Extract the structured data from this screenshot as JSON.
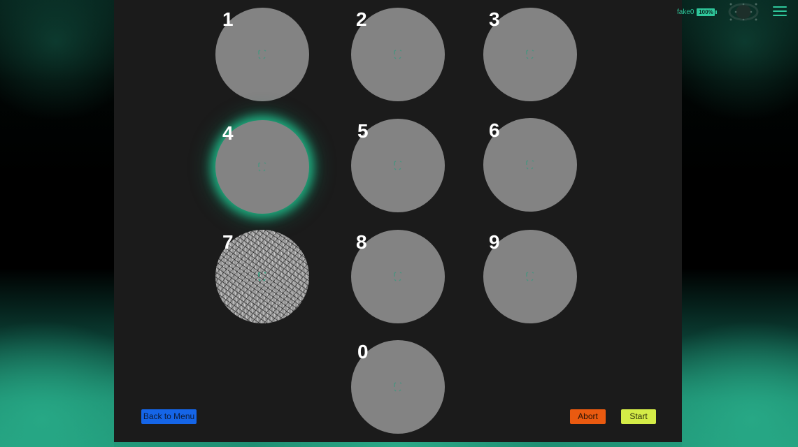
{
  "targets": [
    {
      "label": "1",
      "active": false,
      "noise": false
    },
    {
      "label": "2",
      "active": false,
      "noise": false
    },
    {
      "label": "3",
      "active": false,
      "noise": false
    },
    {
      "label": "4",
      "active": true,
      "noise": false
    },
    {
      "label": "5",
      "active": false,
      "noise": false
    },
    {
      "label": "6",
      "active": false,
      "noise": false
    },
    {
      "label": "7",
      "active": false,
      "noise": true
    },
    {
      "label": "8",
      "active": false,
      "noise": false
    },
    {
      "label": "9",
      "active": false,
      "noise": false
    },
    {
      "label": "0",
      "active": false,
      "noise": false
    }
  ],
  "buttons": {
    "back": "Back to Menu",
    "abort": "Abort",
    "start": "Start"
  },
  "status": {
    "device": "fake0",
    "battery": "100%"
  },
  "icons": {
    "headset": "headset-icon",
    "menu": "hamburger-menu-icon",
    "target_mark": "fixation-mark-icon"
  },
  "colors": {
    "accent": "#2fc79b",
    "panel": "#1b1b1b",
    "target": "#838383",
    "back_button": "#1565e8",
    "abort_button": "#ea5a10",
    "start_button": "#d4ec47"
  }
}
